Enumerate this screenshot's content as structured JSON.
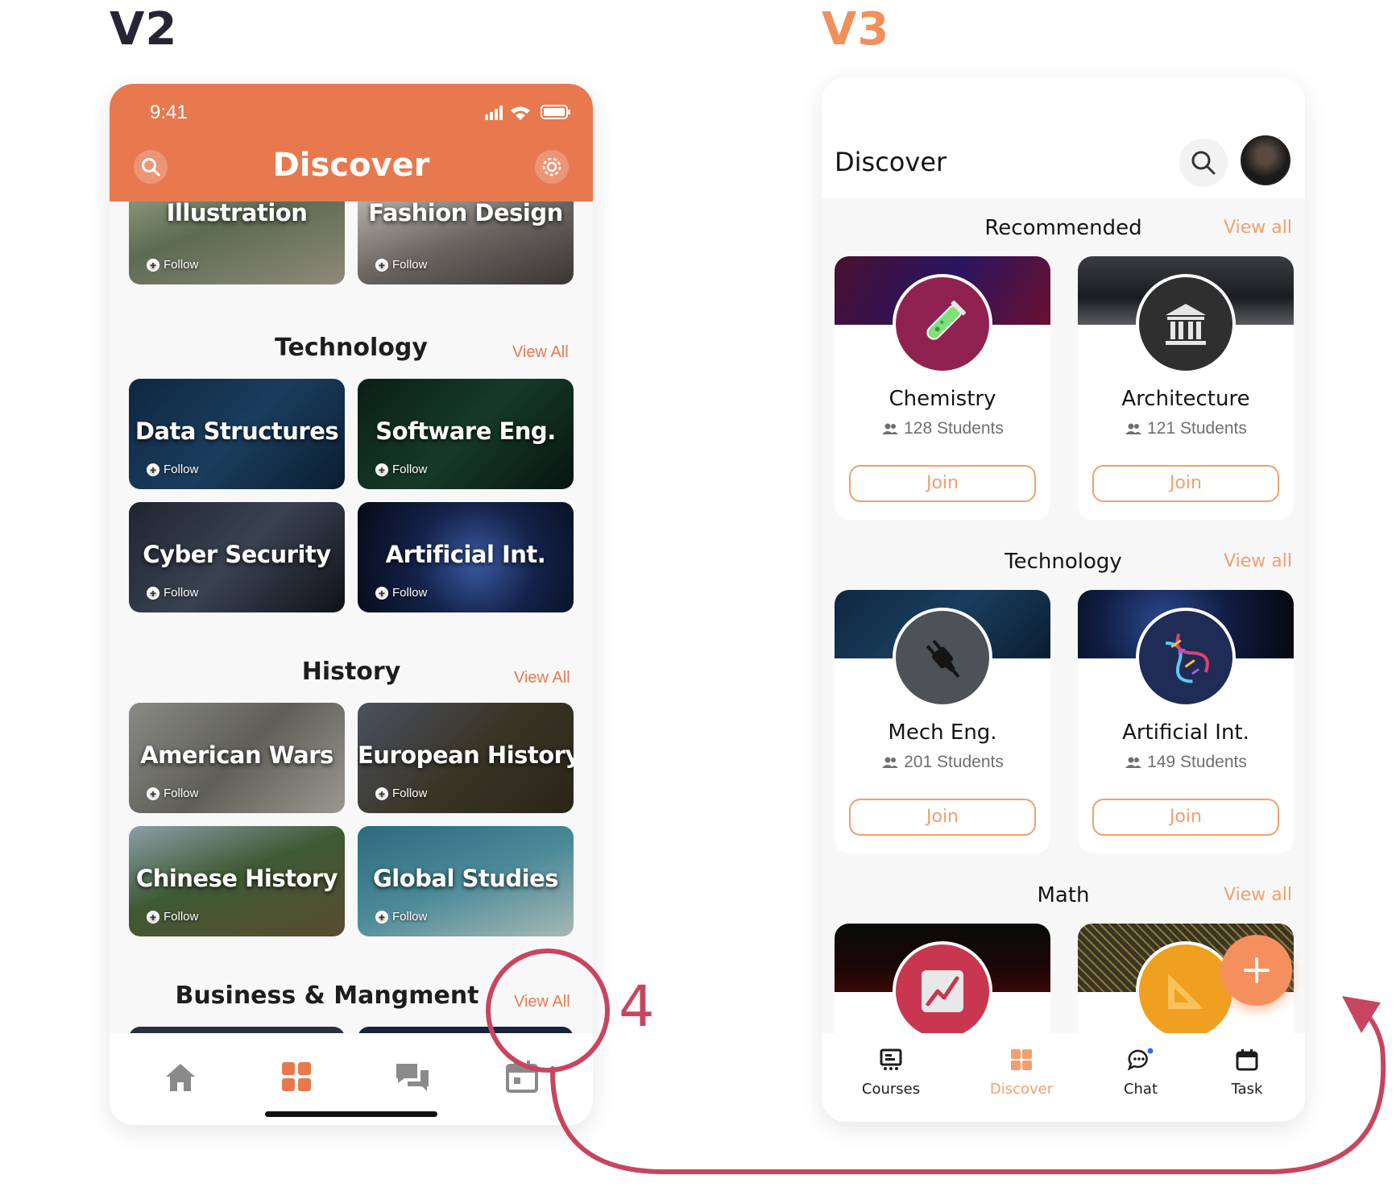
{
  "labels": {
    "v2": "V2",
    "v3": "V3",
    "annotation_number": "4"
  },
  "v2": {
    "status_time": "9:41",
    "title": "Discover",
    "top_tiles": [
      {
        "label": "Illustration",
        "follow": "Follow"
      },
      {
        "label": "Fashion Design",
        "follow": "Follow"
      }
    ],
    "sections": [
      {
        "title": "Technology",
        "view_all": "View All",
        "tiles": [
          {
            "label": "Data Structures",
            "follow": "Follow"
          },
          {
            "label": "Software Eng.",
            "follow": "Follow"
          },
          {
            "label": "Cyber Security",
            "follow": "Follow"
          },
          {
            "label": "Artificial Int.",
            "follow": "Follow"
          }
        ]
      },
      {
        "title": "History",
        "view_all": "View All",
        "tiles": [
          {
            "label": "American Wars",
            "follow": "Follow"
          },
          {
            "label": "European History",
            "follow": "Follow"
          },
          {
            "label": "Chinese History",
            "follow": "Follow"
          },
          {
            "label": "Global Studies",
            "follow": "Follow"
          }
        ]
      },
      {
        "title": "Business & Mangment",
        "view_all": "View All"
      }
    ],
    "tabbar": [
      "home-icon",
      "grid-icon",
      "chat-icon",
      "calendar-icon"
    ]
  },
  "v3": {
    "title": "Discover",
    "sections": [
      {
        "title": "Recommended",
        "view_all": "View all",
        "cards": [
          {
            "name": "Chemistry",
            "students": "128 Students",
            "join": "Join",
            "icon": "flask-icon"
          },
          {
            "name": "Architecture",
            "students": "121 Students",
            "join": "Join",
            "icon": "building-icon"
          }
        ]
      },
      {
        "title": "Technology",
        "view_all": "View all",
        "cards": [
          {
            "name": "Mech Eng.",
            "students": "201 Students",
            "join": "Join",
            "icon": "plug-icon"
          },
          {
            "name": "Artificial Int.",
            "students": "149 Students",
            "join": "Join",
            "icon": "dna-icon"
          }
        ]
      },
      {
        "title": "Math",
        "view_all": "View all",
        "cards": [
          {
            "icon": "chart-icon"
          },
          {
            "icon": "set-square-icon"
          }
        ]
      }
    ],
    "tabbar": [
      {
        "label": "Courses",
        "icon": "courses-icon"
      },
      {
        "label": "Discover",
        "icon": "grid-icon",
        "active": true
      },
      {
        "label": "Chat",
        "icon": "chat-icon"
      },
      {
        "label": "Task",
        "icon": "calendar-icon"
      }
    ]
  },
  "colors": {
    "v2_accent": "#e8794f",
    "v3_accent": "#f0a070",
    "annotation": "#c8455f",
    "v2_label": "#262533"
  }
}
